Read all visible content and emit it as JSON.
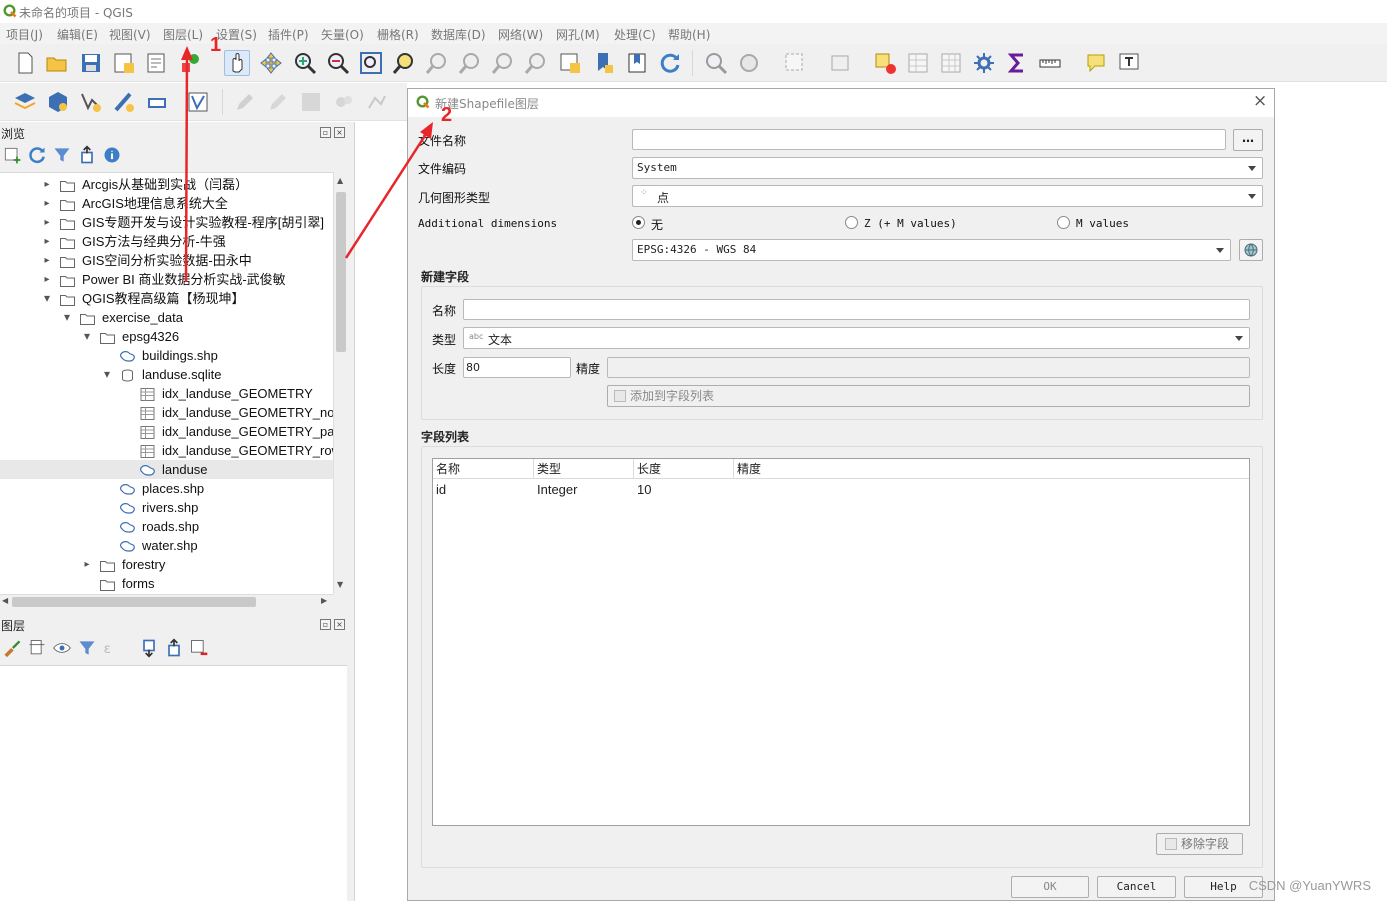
{
  "window": {
    "title": "未命名的项目 - QGIS"
  },
  "menu": [
    "项目(J)",
    "编辑(E)",
    "视图(V)",
    "图层(L)",
    "设置(S)",
    "插件(P)",
    "矢量(O)",
    "栅格(R)",
    "数据库(D)",
    "网络(W)",
    "网孔(M)",
    "处理(C)",
    "帮助(H)"
  ],
  "annotations": {
    "step1": "1",
    "step2": "2",
    "accent": "#e8262a"
  },
  "browser": {
    "title": "浏览",
    "items": [
      {
        "label": "Arcgis从基础到实战（闫磊）",
        "depth": 0,
        "icon": "folder-icon",
        "expander": "collapsed"
      },
      {
        "label": "ArcGIS地理信息系统大全",
        "depth": 0,
        "icon": "folder-icon",
        "expander": "collapsed"
      },
      {
        "label": "GIS专题开发与设计实验教程-程序[胡引翠]",
        "depth": 0,
        "icon": "folder-icon",
        "expander": "collapsed"
      },
      {
        "label": "GIS方法与经典分析-牛强",
        "depth": 0,
        "icon": "folder-icon",
        "expander": "collapsed"
      },
      {
        "label": "GIS空间分析实验数据-田永中",
        "depth": 0,
        "icon": "folder-icon",
        "expander": "collapsed"
      },
      {
        "label": "Power BI 商业数据分析实战-武俊敏",
        "depth": 0,
        "icon": "folder-icon",
        "expander": "collapsed"
      },
      {
        "label": "QGIS教程高级篇【杨现坤】",
        "depth": 0,
        "icon": "folder-icon",
        "expander": "expanded"
      },
      {
        "label": "exercise_data",
        "depth": 1,
        "icon": "folder-icon",
        "expander": "expanded"
      },
      {
        "label": "epsg4326",
        "depth": 2,
        "icon": "folder-icon",
        "expander": "expanded"
      },
      {
        "label": "buildings.shp",
        "depth": 3,
        "icon": "polygon-layer-icon",
        "expander": "none"
      },
      {
        "label": "landuse.sqlite",
        "depth": 3,
        "icon": "database-icon",
        "expander": "expanded"
      },
      {
        "label": "idx_landuse_GEOMETRY",
        "depth": 4,
        "icon": "table-icon",
        "expander": "none"
      },
      {
        "label": "idx_landuse_GEOMETRY_node",
        "depth": 4,
        "icon": "table-icon",
        "expander": "none"
      },
      {
        "label": "idx_landuse_GEOMETRY_parent",
        "depth": 4,
        "icon": "table-icon",
        "expander": "none"
      },
      {
        "label": "idx_landuse_GEOMETRY_rowid",
        "depth": 4,
        "icon": "table-icon",
        "expander": "none"
      },
      {
        "label": "landuse",
        "depth": 4,
        "icon": "polygon-layer-icon",
        "expander": "none",
        "selected": true
      },
      {
        "label": "places.shp",
        "depth": 3,
        "icon": "polygon-layer-icon",
        "expander": "none"
      },
      {
        "label": "rivers.shp",
        "depth": 3,
        "icon": "polygon-layer-icon",
        "expander": "none"
      },
      {
        "label": "roads.shp",
        "depth": 3,
        "icon": "polygon-layer-icon",
        "expander": "none"
      },
      {
        "label": "water.shp",
        "depth": 3,
        "icon": "polygon-layer-icon",
        "expander": "none"
      },
      {
        "label": "forestry",
        "depth": 2,
        "icon": "folder-icon",
        "expander": "collapsed"
      },
      {
        "label": "forms",
        "depth": 2,
        "icon": "folder-icon",
        "expander": "none"
      }
    ]
  },
  "layers": {
    "title": "图层"
  },
  "dialog": {
    "title": "新建Shapefile图层",
    "file_name_label": "文件名称",
    "file_name_value": "",
    "browse_button": "…",
    "encoding_label": "文件编码",
    "encoding_value": "System",
    "geometry_label": "几何图形类型",
    "geometry_value": "点",
    "dimensions_label": "Additional dimensions",
    "dim_none": "无",
    "dim_z": "Z (+ M values)",
    "dim_m": "M values",
    "crs_value": "EPSG:4326 - WGS 84",
    "new_field_title": "新建字段",
    "name_label": "名称",
    "name_value": "",
    "type_label": "类型",
    "type_badge": "abc",
    "type_value": "文本",
    "length_label": "长度",
    "length_value": "80",
    "precision_label": "精度",
    "precision_value": "",
    "add_field_button": "添加到字段列表",
    "field_list_title": "字段列表",
    "columns": [
      "名称",
      "类型",
      "长度",
      "精度"
    ],
    "rows": [
      [
        "id",
        "Integer",
        "10",
        ""
      ]
    ],
    "remove_field_button": "移除字段",
    "ok_button": "OK",
    "cancel_button": "Cancel",
    "help_button": "Help"
  },
  "watermark": "CSDN @YuanYWRS"
}
